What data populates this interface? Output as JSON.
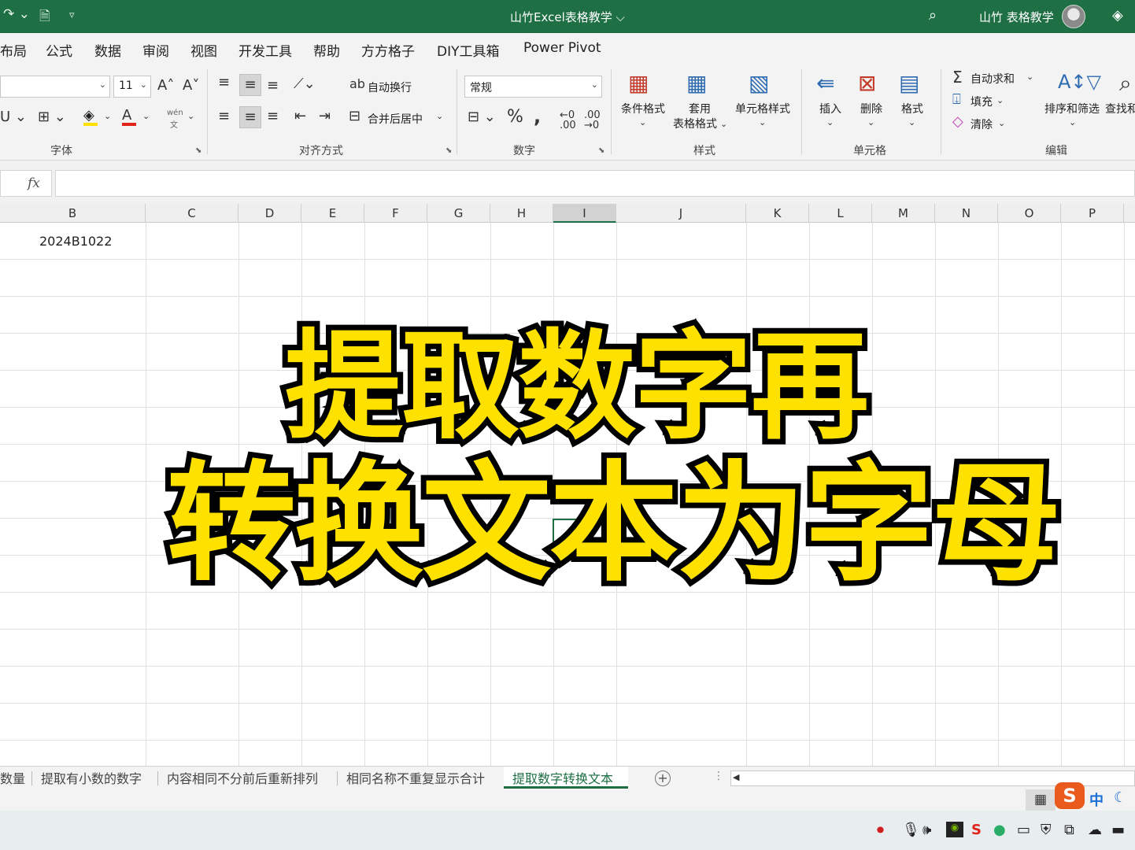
{
  "window": {
    "title": "山竹Excel表格教学 ⌵",
    "user_name": "山竹 表格教学"
  },
  "ribbon_tabs": [
    "布局",
    "公式",
    "数据",
    "审阅",
    "视图",
    "开发工具",
    "帮助",
    "方方格子",
    "DIY工具箱",
    "Power Pivot"
  ],
  "ribbon": {
    "font_size": "11",
    "wrap_text": "自动换行",
    "merge_center": "合并后居中",
    "number_format": "常规",
    "cond_format": "条件格式",
    "table_format_1": "套用",
    "table_format_2": "表格格式",
    "cell_style": "单元格样式",
    "insert": "插入",
    "delete": "删除",
    "format": "格式",
    "autosum": "自动求和",
    "fill": "填充",
    "clear": "清除",
    "sort_filter": "排序和筛选",
    "find_select": "查找和",
    "groups": {
      "font": "字体",
      "align": "对齐方式",
      "number": "数字",
      "styles": "样式",
      "cells": "单元格",
      "editing": "编辑"
    },
    "pinyin_top": "wén",
    "pinyin_bottom": "文"
  },
  "formula_bar": {
    "fx": "fx",
    "value": ""
  },
  "columns": [
    "B",
    "C",
    "D",
    "E",
    "F",
    "G",
    "H",
    "I",
    "J",
    "K",
    "L",
    "M",
    "N",
    "O",
    "P"
  ],
  "active_column": "I",
  "cells": {
    "b1": "2024B1022"
  },
  "overlay": {
    "line1": "提取数字再",
    "line2": "转换文本为字母"
  },
  "sheet_tabs": [
    "数量",
    "提取有小数的数字",
    "内容相同不分前后重新排列",
    "相同名称不重复显示合计",
    "提取数字转换文本"
  ],
  "active_sheet": "提取数字转换文本",
  "ime": {
    "logo": "S",
    "mode": "中"
  },
  "colors": {
    "excel_green": "#1e6f44",
    "overlay_yellow": "#ffe100"
  },
  "icons": [
    "redo-icon",
    "file-icon",
    "customize-icon",
    "search-icon",
    "diamond-icon",
    "record-icon",
    "mic-icon",
    "speaker-icon",
    "nvidia-icon",
    "sogou-icon",
    "wechat-icon",
    "monitor-icon",
    "shield-icon",
    "cloud-off-icon",
    "battery-icon"
  ]
}
